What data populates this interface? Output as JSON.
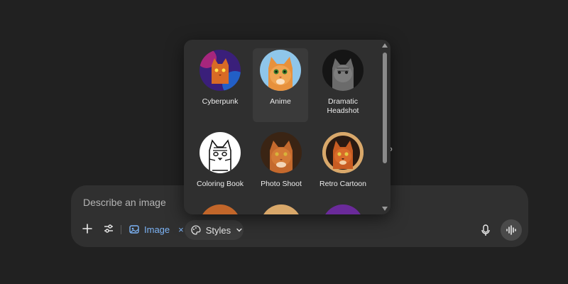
{
  "composer": {
    "placeholder": "Describe an image",
    "image_chip_label": "Image",
    "image_chip_close": "×",
    "styles_label": "Styles"
  },
  "styles_menu": {
    "items": [
      {
        "label": "Cyberpunk"
      },
      {
        "label": "Anime"
      },
      {
        "label": "Dramatic\nHeadshot"
      },
      {
        "label": "Coloring Book"
      },
      {
        "label": "Photo Shoot"
      },
      {
        "label": "Retro Cartoon"
      }
    ]
  },
  "colors": {
    "background": "#212121",
    "composer": "#303030",
    "popup": "#2f2f2f",
    "accent_blue": "#7cb3f5"
  },
  "icons": [
    "plus-icon",
    "tune-icon",
    "image-icon",
    "palette-icon",
    "chevron-down-icon",
    "mic-icon",
    "voice-wave-icon"
  ]
}
